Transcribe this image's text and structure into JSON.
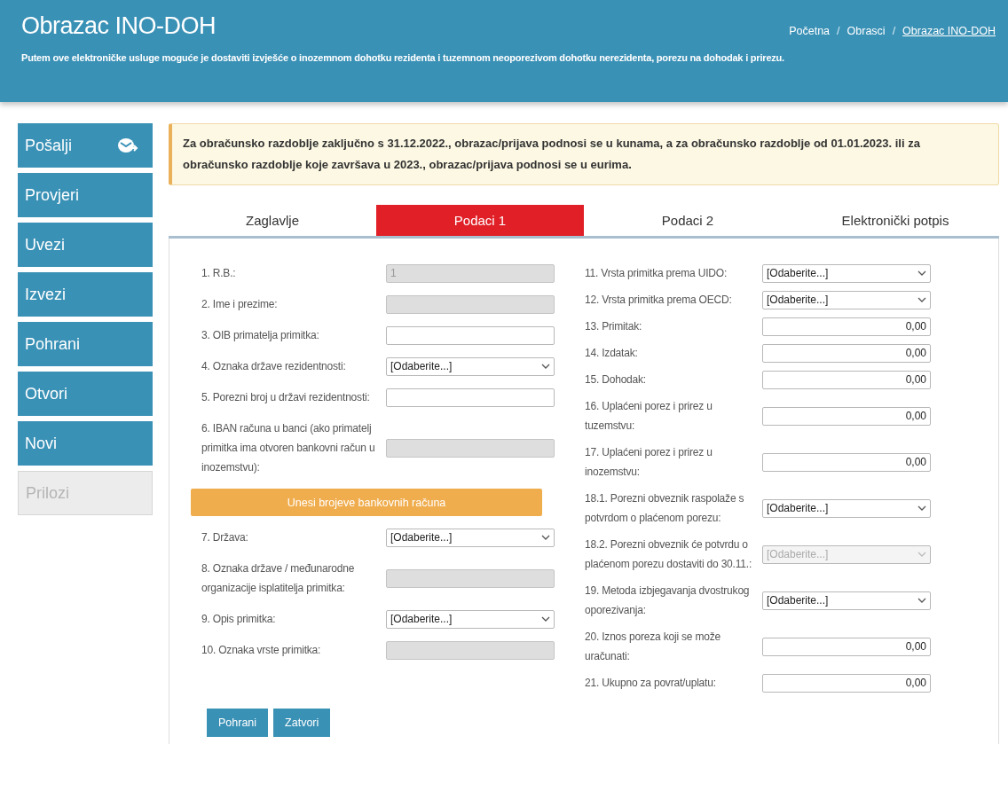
{
  "header": {
    "title": "Obrazac INO-DOH",
    "description": "Putem ove elektroničke usluge moguće je dostaviti izvješće o inozemnom dohotku rezidenta i tuzemnom neoporezivom dohotku nerezidenta, porezu na dohodak i prirezu.",
    "breadcrumbs": [
      {
        "label": "Početna",
        "current": false
      },
      {
        "label": "Obrasci",
        "current": false
      },
      {
        "label": "Obrazac INO-DOH",
        "current": true
      }
    ],
    "separator": "/"
  },
  "sidebar": [
    {
      "label": "Pošalji",
      "disabled": false,
      "icon": true
    },
    {
      "label": "Provjeri",
      "disabled": false,
      "icon": false
    },
    {
      "label": "Uvezi",
      "disabled": false,
      "icon": false
    },
    {
      "label": "Izvezi",
      "disabled": false,
      "icon": false
    },
    {
      "label": "Pohrani",
      "disabled": false,
      "icon": false
    },
    {
      "label": "Otvori",
      "disabled": false,
      "icon": false
    },
    {
      "label": "Novi",
      "disabled": false,
      "icon": false
    },
    {
      "label": "Prilozi",
      "disabled": true,
      "icon": false
    }
  ],
  "notice": "Za obračunsko razdoblje zaključno s 31.12.2022., obrazac/prijava podnosi se u kunama, a za obračunsko razdoblje od 01.01.2023. ili za obračunsko razdoblje koje završava u 2023., obrazac/prijava podnosi se u eurima.",
  "tabs": [
    {
      "label": "Zaglavlje",
      "selected": false
    },
    {
      "label": "Podaci 1",
      "selected": true
    },
    {
      "label": "Podaci 2",
      "selected": false
    },
    {
      "label": "Elektronički potpis",
      "selected": false
    }
  ],
  "left_fields": [
    {
      "kind": "text",
      "label": "1. R.B.:",
      "value": "1",
      "disabled": true
    },
    {
      "kind": "text",
      "label": "2. Ime i prezime:",
      "disabled": true
    },
    {
      "kind": "text",
      "label": "3. OIB primatelja primitka:",
      "disabled": false
    },
    {
      "kind": "select",
      "label": "4. Oznaka države rezidentnosti:",
      "value": "[Odaberite...]",
      "disabled": false
    },
    {
      "kind": "text",
      "label": "5. Porezni broj u državi rezidentnosti:",
      "disabled": false
    },
    {
      "kind": "text",
      "label": "6. IBAN računa u banci (ako primatelj primitka ima otvoren bankovni račun u inozemstvu):",
      "disabled": true
    },
    {
      "kind": "action",
      "label": "Unesi brojeve bankovnih računa"
    },
    {
      "kind": "select",
      "label": "7. Država:",
      "value": "[Odaberite...]",
      "disabled": false
    },
    {
      "kind": "text",
      "label": "8. Oznaka države / međunarodne organizacije isplatitelja primitka:",
      "disabled": true
    },
    {
      "kind": "select",
      "label": "9. Opis primitka:",
      "value": "[Odaberite...]",
      "disabled": false
    },
    {
      "kind": "text",
      "label": "10. Oznaka vrste primitka:",
      "disabled": true
    }
  ],
  "right_fields": [
    {
      "kind": "select",
      "label": "11. Vrsta primitka prema UIDO:",
      "value": "[Odaberite...]",
      "disabled": false
    },
    {
      "kind": "select",
      "label": "12. Vrsta primitka prema OECD:",
      "value": "[Odaberite...]",
      "disabled": false
    },
    {
      "kind": "amount",
      "label": "13. Primitak:",
      "value": "0,00",
      "disabled": false
    },
    {
      "kind": "amount",
      "label": "14. Izdatak:",
      "value": "0,00",
      "disabled": false
    },
    {
      "kind": "amount",
      "label": "15. Dohodak:",
      "value": "0,00",
      "disabled": false
    },
    {
      "kind": "amount",
      "label": "16. Uplaćeni porez i prirez u tuzemstvu:",
      "value": "0,00",
      "disabled": false
    },
    {
      "kind": "amount",
      "label": "17. Uplaćeni porez i prirez u inozemstvu:",
      "value": "0,00",
      "disabled": false
    },
    {
      "kind": "select",
      "label": "18.1. Porezni obveznik raspolaže s potvrdom o plaćenom porezu:",
      "value": "[Odaberite...]",
      "disabled": false
    },
    {
      "kind": "select",
      "label": "18.2. Porezni obveznik će potvrdu o plaćenom porezu dostaviti do 30.11.:",
      "value": "[Odaberite...]",
      "disabled": true
    },
    {
      "kind": "select",
      "label": "19. Metoda izbjegavanja dvostrukog oporezivanja:",
      "value": "[Odaberite...]",
      "disabled": false
    },
    {
      "kind": "amount",
      "label": "20. Iznos poreza koji se može uračunati:",
      "value": "0,00",
      "disabled": false
    },
    {
      "kind": "amount",
      "label": "21. Ukupno za povrat/uplatu:",
      "value": "0,00",
      "disabled": false
    }
  ],
  "buttons": [
    "Pohrani",
    "Zatvori"
  ]
}
